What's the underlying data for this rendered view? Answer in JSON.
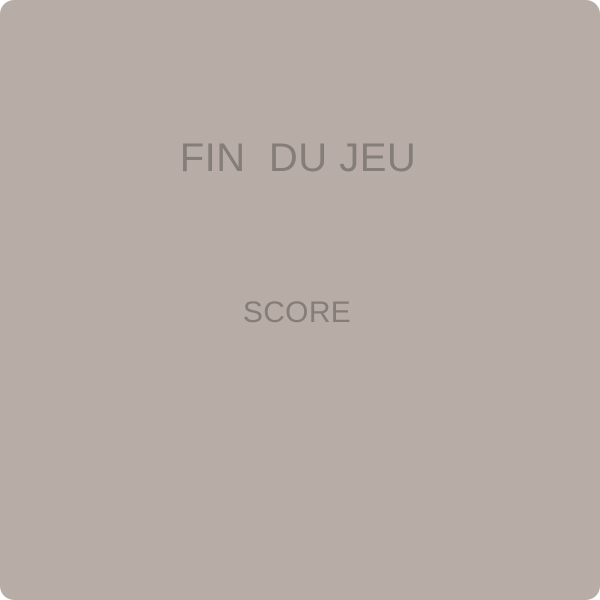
{
  "game_over": {
    "title": "FIN  DU JEU",
    "score_label": "SCORE"
  },
  "colors": {
    "panel_background": "#b8ada6",
    "text": "#847d78"
  }
}
